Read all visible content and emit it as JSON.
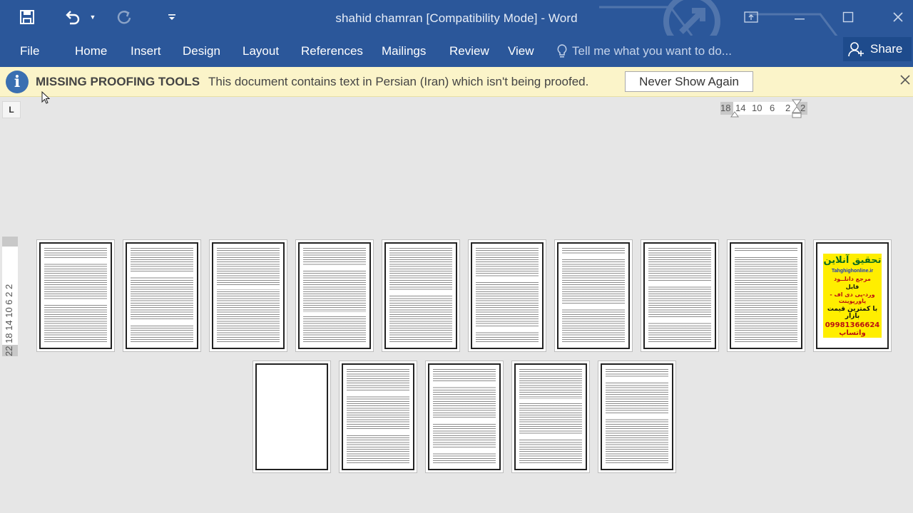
{
  "titlebar": {
    "document_title": "shahid chamran [Compatibility Mode] - Word",
    "icons": {
      "save": "save-icon",
      "undo": "undo-icon",
      "redo": "redo-icon",
      "customize": "customize-qat-icon"
    },
    "color": "#2b579a"
  },
  "ribbon": {
    "tabs": [
      "File",
      "Home",
      "Insert",
      "Design",
      "Layout",
      "References",
      "Mailings",
      "Review",
      "View"
    ],
    "tell_me": "Tell me what you want to do...",
    "share": "Share"
  },
  "message_bar": {
    "title": "MISSING PROOFING TOOLS",
    "text": "This document contains text in Persian (Iran) which isn't being proofed.",
    "button": "Never Show Again",
    "background": "#fbf4c9"
  },
  "ruler": {
    "tab_selector": "L",
    "horizontal_marks": [
      "18",
      "14",
      "10",
      "6",
      "2",
      "2"
    ],
    "vertical_text": "22 18 14 10 6 2 2"
  },
  "pages": {
    "total": 15,
    "ad_page": {
      "line1": "تحقیق آنلاین",
      "line2": "Tahghighonline.ir",
      "line3": "مرجع دانلــود",
      "line4": "فایل",
      "line5": "ورد-پی دی اف - پاورپوینت",
      "line6": "با کمترین قیمت بازار",
      "line7": "09981366624 واتساپ"
    }
  }
}
